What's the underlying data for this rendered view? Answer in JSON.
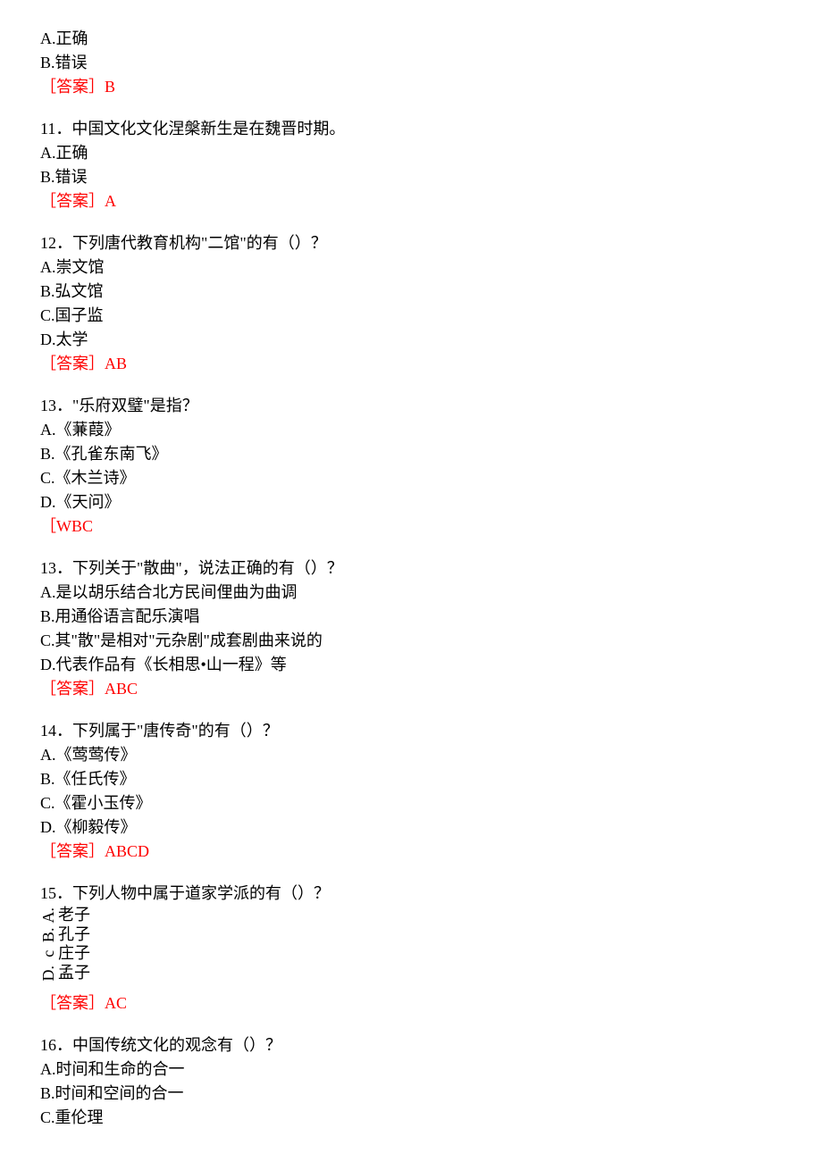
{
  "q_partial": {
    "options": [
      {
        "label": "A.",
        "text": "正确"
      },
      {
        "label": "B.",
        "text": "错误"
      }
    ],
    "answer_label": "［答案］",
    "answer": "B"
  },
  "q11": {
    "number": "11",
    "text": "．中国文化文化涅槃新生是在魏晋时期。",
    "options": [
      {
        "label": "A.",
        "text": "正确"
      },
      {
        "label": "B.",
        "text": "错误"
      }
    ],
    "answer_label": "［答案］",
    "answer": "A"
  },
  "q12": {
    "number": "12",
    "text": "．下列唐代教育机构\"二馆\"的有（）？",
    "options": [
      {
        "label": "A.",
        "text": "崇文馆"
      },
      {
        "label": "B.",
        "text": "弘文馆"
      },
      {
        "label": "C.",
        "text": "国子监"
      },
      {
        "label": "D.",
        "text": "太学"
      }
    ],
    "answer_label": "［答案］",
    "answer": "AB"
  },
  "q13a": {
    "number": "13",
    "text": "．\"乐府双璧\"是指？",
    "options": [
      {
        "label": "A.",
        "text": "《蒹葭》"
      },
      {
        "label": "B.",
        "text": "《孔雀东南飞》"
      },
      {
        "label": "C.",
        "text": "《木兰诗》"
      },
      {
        "label": "D.",
        "text": "《天问》"
      }
    ],
    "answer_label": "［WBC"
  },
  "q13b": {
    "number": "13",
    "text": "．下列关于\"散曲\"，说法正确的有（）？",
    "options": [
      {
        "label": "A.",
        "text": "是以胡乐结合北方民间俚曲为曲调"
      },
      {
        "label": "B.",
        "text": "用通俗语言配乐演唱"
      },
      {
        "label": "C.",
        "text": "其\"散\"是相对\"元杂剧\"成套剧曲来说的"
      },
      {
        "label": "D.",
        "text": "代表作品有《长相思•山一程》等"
      }
    ],
    "answer_label": "［答案］",
    "answer": "ABC"
  },
  "q14": {
    "number": "14",
    "text": "．下列属于\"唐传奇\"的有（）？",
    "options": [
      {
        "label": "A.",
        "text": "《莺莺传》"
      },
      {
        "label": "B.",
        "text": "《任氏传》"
      },
      {
        "label": "C.",
        "text": "《霍小玉传》"
      },
      {
        "label": "D.",
        "text": "《柳毅传》"
      }
    ],
    "answer_label": "［答案］",
    "answer": "ABCD"
  },
  "q15": {
    "number": "15",
    "text": "．下列人物中属于道家学派的有（）？",
    "special_options": [
      {
        "label": "A.",
        "text": "老子"
      },
      {
        "label": "B.",
        "text": "孔子"
      },
      {
        "label": "c",
        "text": "庄子"
      },
      {
        "label": "D.",
        "text": "孟子"
      }
    ],
    "answer_label": "［答案］",
    "answer": "AC"
  },
  "q16": {
    "number": "16",
    "text": "．中国传统文化的观念有（）？",
    "options": [
      {
        "label": "A.",
        "text": "时间和生命的合一"
      },
      {
        "label": "B.",
        "text": "时间和空间的合一"
      },
      {
        "label": "C.",
        "text": "重伦理"
      }
    ]
  }
}
